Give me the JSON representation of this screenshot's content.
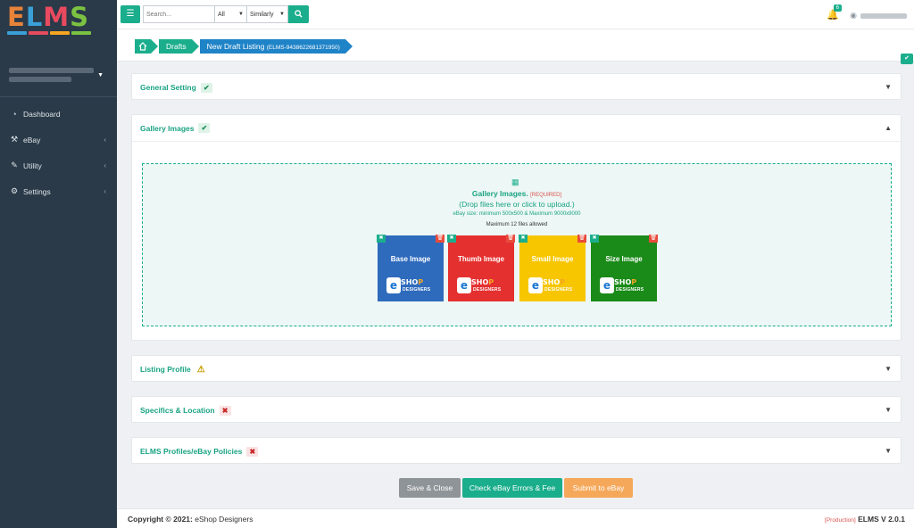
{
  "app": {
    "logo_letters": [
      "E",
      "L",
      "M",
      "S"
    ],
    "logo_colors": [
      "#e8833a",
      "#3aa0d8",
      "#e84a5f",
      "#7cc242"
    ]
  },
  "sidebar": {
    "items": [
      {
        "label": "Dashboard",
        "icon": "dashboard-icon",
        "glyph": "⏲"
      },
      {
        "label": "eBay",
        "icon": "hammer-icon",
        "glyph": "⚒"
      },
      {
        "label": "Utility",
        "icon": "wrench-icon",
        "glyph": "🔧"
      },
      {
        "label": "Settings",
        "icon": "gears-icon",
        "glyph": "⚙"
      }
    ]
  },
  "topbar": {
    "search_placeholder": "Search...",
    "filter_value": "All",
    "match_value": "Similarly",
    "notification_count": "6"
  },
  "breadcrumb": {
    "items": [
      "Drafts"
    ],
    "current_label": "New Draft Listing",
    "current_id": "(ELMS-9438622681371950)"
  },
  "panels": {
    "general": {
      "title": "General Setting",
      "status": "ok"
    },
    "gallery": {
      "title": "Gallery Images",
      "status": "ok"
    },
    "listing": {
      "title": "Listing Profile",
      "status": "warn"
    },
    "specifics": {
      "title": "Specifics & Location",
      "status": "err"
    },
    "profiles": {
      "title": "ELMS Profiles/eBay Policies",
      "status": "err"
    }
  },
  "gallery": {
    "title": "Gallery Images.",
    "required": "[REQUIRED]",
    "instruction": "(Drop files here or click to upload.)",
    "size_note": "eBay size: minimum 500x500 & Maximum 9000x9000",
    "max_note": "Maximum 12 files allowed",
    "tiles": [
      {
        "label": "Base Image",
        "color": "#2e6bbd"
      },
      {
        "label": "Thumb Image",
        "color": "#e53030"
      },
      {
        "label": "Small Image",
        "color": "#f7c600"
      },
      {
        "label": "Size Image",
        "color": "#1a8a18"
      }
    ],
    "logo_shop_a": "SHO",
    "logo_shop_b": "P",
    "logo_designers": "DESIGNERS"
  },
  "actions": {
    "save_close": "Save & Close",
    "check_errors": "Check eBay Errors & Fee",
    "submit": "Submit to eBay"
  },
  "footer": {
    "copyright_bold": "Copyright © 2021:",
    "copyright_rest": " eShop Designers",
    "env": "[Production]",
    "version": "ELMS V 2.0.1"
  }
}
